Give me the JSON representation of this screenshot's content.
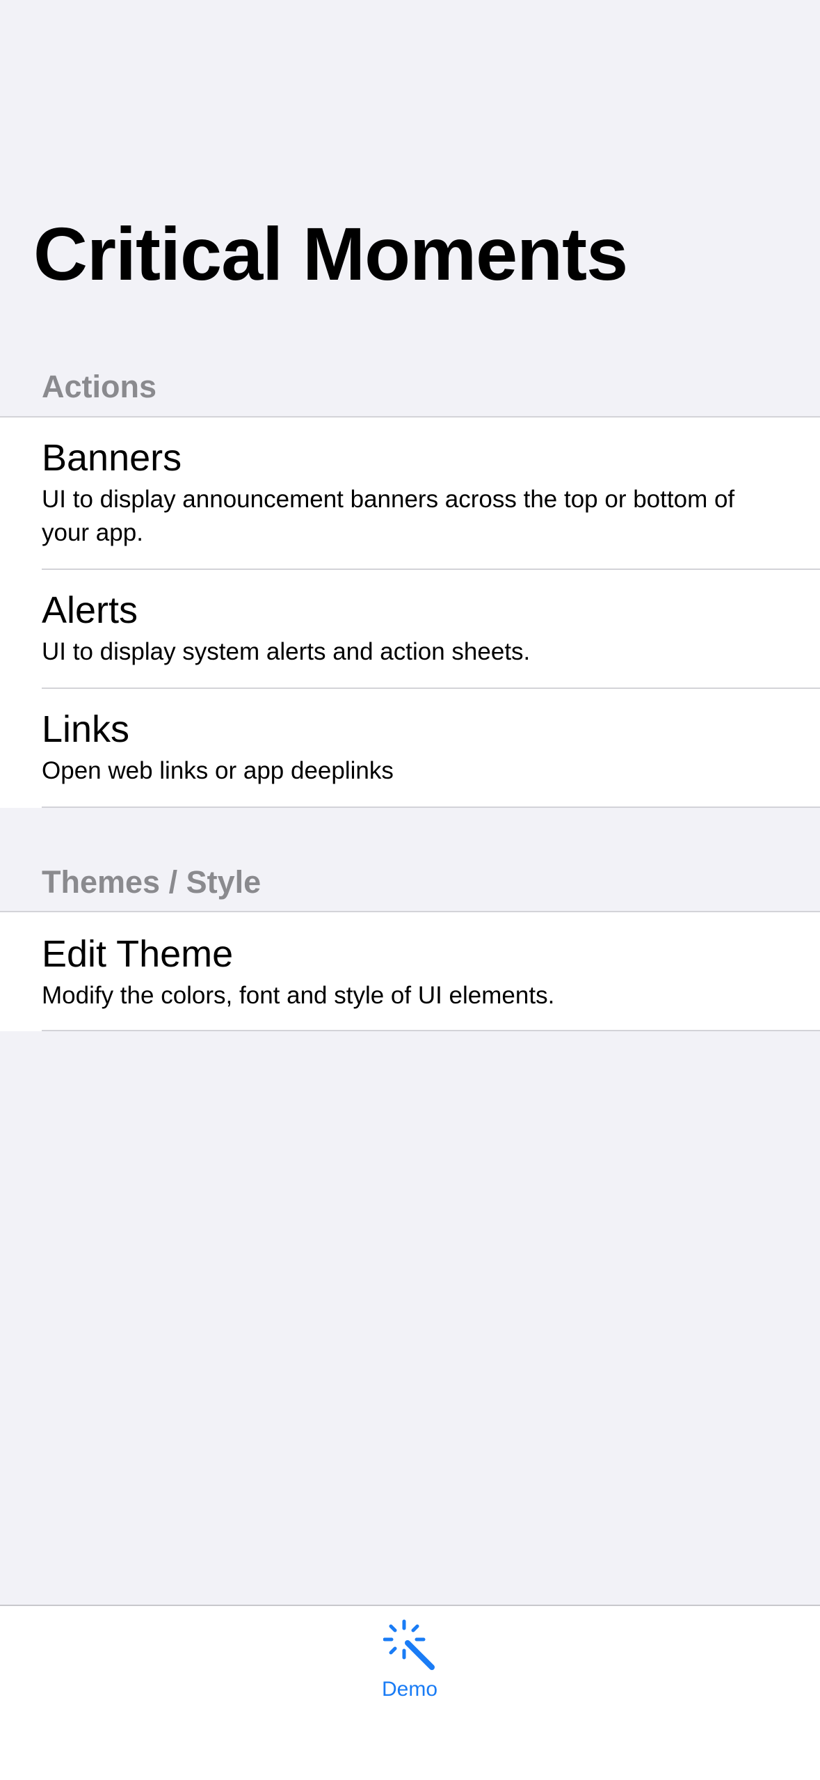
{
  "navigation": {
    "title": "Critical Moments"
  },
  "sections": [
    {
      "header": "Actions",
      "rows": [
        {
          "title": "Banners",
          "subtitle": "UI to display announcement banners across the top or bottom of your app."
        },
        {
          "title": "Alerts",
          "subtitle": "UI to display system alerts and action sheets."
        },
        {
          "title": "Links",
          "subtitle": "Open web links or app deeplinks"
        }
      ]
    },
    {
      "header": "Themes / Style",
      "rows": [
        {
          "title": "Edit Theme",
          "subtitle": "Modify the colors, font and style of UI elements."
        }
      ]
    }
  ],
  "tab_bar": {
    "items": [
      {
        "label": "Demo",
        "icon": "magic-wand-icon",
        "selected": true
      }
    ]
  },
  "colors": {
    "accent": "#1a7cf5",
    "background": "#f2f2f7",
    "section_header": "#8a8a8e",
    "separator": "#d3d3d8"
  }
}
